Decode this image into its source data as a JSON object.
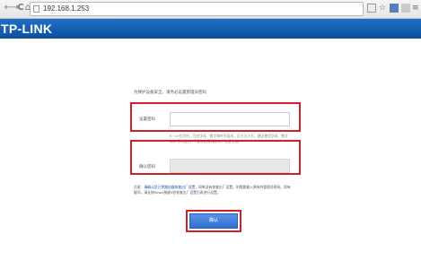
{
  "browser": {
    "url": "192.168.1.253",
    "back_glyph": "←",
    "forward_glyph": "→",
    "reload_glyph": "C",
    "home_glyph": "⌂",
    "star_glyph": "☆",
    "menu_glyph": "≡"
  },
  "header": {
    "logo_text": "TP-LINK",
    "background": "#1a64b8"
  },
  "login": {
    "intro": "为保护设备安全，请务必设置管理员密码",
    "password_label": "设置密码",
    "password_value": "",
    "hint": "6~15位字符，可由字母、数字和符号组成，区分大小写，建议使用字母、数字和符号的组合，不建议使用纯数字，包括空格。",
    "confirm_label": "确认密码",
    "confirm_value": "",
    "notice_prefix": "注意：",
    "notice_link": "请确认您已将路由器恢复出厂设置",
    "notice_rest": "，如果没有恢复出厂设置，则需要输入原有的管理员密码。如有疑问，请长按Reset按键5秒恢复出厂设置后再进行设置。",
    "confirm_button": "确认",
    "highlight_color": "#d0202a",
    "button_color": "#3a7bdc"
  }
}
